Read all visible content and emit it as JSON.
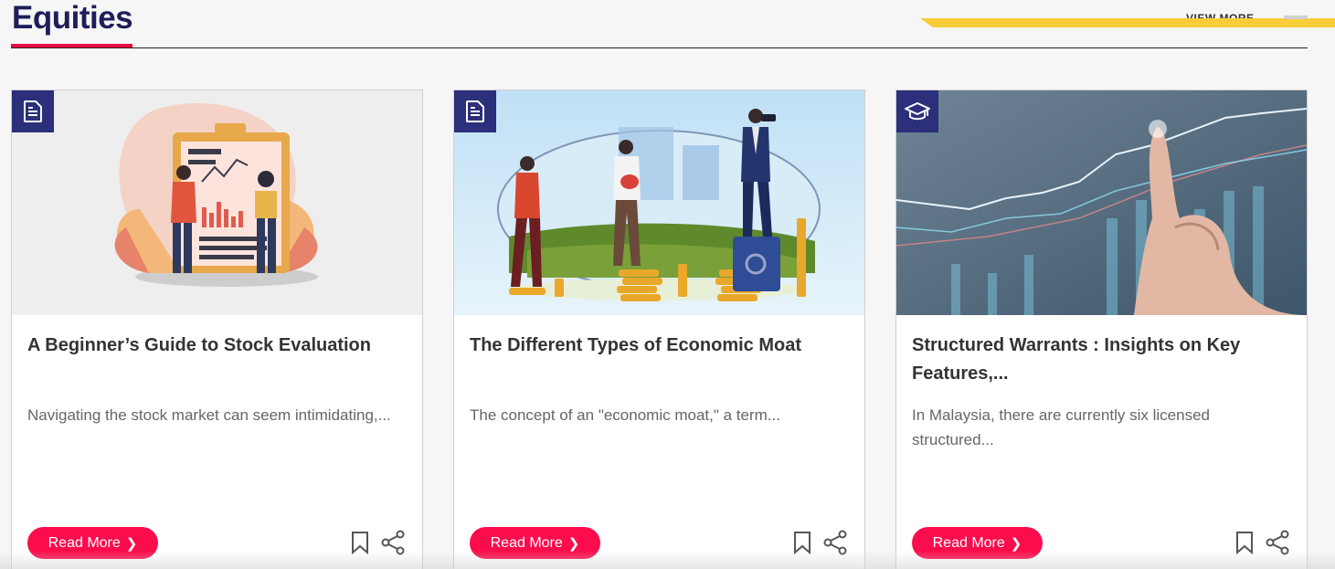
{
  "section": {
    "title": "Equities",
    "view_more_label": "VIEW MORE"
  },
  "cards": [
    {
      "type_icon": "document-icon",
      "title": "A Beginner’s Guide to Stock Evaluation",
      "excerpt": "Navigating the stock market can seem intimidating,...",
      "read_more_label": "Read More",
      "bookmark_icon": "bookmark-icon",
      "share_icon": "share-icon"
    },
    {
      "type_icon": "document-icon",
      "title": "The Different Types of Economic Moat",
      "excerpt": "The concept of an \"economic moat,\" a term...",
      "read_more_label": "Read More",
      "bookmark_icon": "bookmark-icon",
      "share_icon": "share-icon"
    },
    {
      "type_icon": "graduation-cap-icon",
      "title": "Structured Warrants : Insights on Key Features,...",
      "excerpt": "In Malaysia, there are currently six licensed structured...",
      "read_more_label": "Read More",
      "bookmark_icon": "bookmark-icon",
      "share_icon": "share-icon"
    }
  ],
  "colors": {
    "brand_navy": "#2c2f7a",
    "accent_red": "#fb0d4d",
    "accent_yellow": "#f9cd3a"
  }
}
